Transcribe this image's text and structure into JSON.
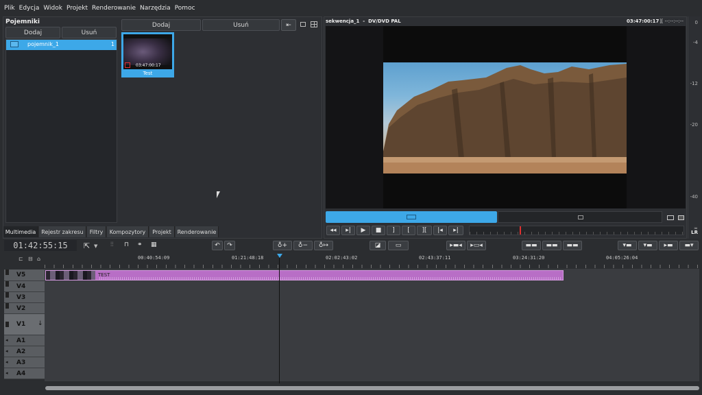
{
  "menu": [
    "Plik",
    "Edycja",
    "Widok",
    "Projekt",
    "Renderowanie",
    "Narzędzia",
    "Pomoc"
  ],
  "bins": {
    "title": "Pojemniki",
    "add_label": "Dodaj",
    "remove_label": "Usuń",
    "items": [
      {
        "name": "pojemnik_1",
        "count": "1"
      }
    ]
  },
  "media": {
    "add_label": "Dodaj",
    "remove_label": "Usuń",
    "clip": {
      "duration": "03:47:00:17",
      "name": "Test"
    }
  },
  "tabs": [
    "Multimedia",
    "Rejestr zakresu",
    "Filtry",
    "Kompozytory",
    "Projekt",
    "Renderowanie"
  ],
  "viewer": {
    "title": "sekwencja_1  -  DV/DVD PAL",
    "timecode": "03:47:00:17",
    "inout": "][ --:--:--:--"
  },
  "vu": {
    "scale": [
      "0",
      "-4",
      "-12",
      "-20",
      "-40",
      "∞"
    ],
    "channels": "LR"
  },
  "timeline": {
    "timecode": "01:42:55:15",
    "ruler": [
      "00:40:54:09",
      "01:21:48:18",
      "02:02:43:02",
      "02:43:37:11",
      "03:24:31:20",
      "04:05:26:04"
    ],
    "clip_label": "TEST",
    "tracks": [
      "V5",
      "V4",
      "V3",
      "V2",
      "V1",
      "A1",
      "A2",
      "A3",
      "A4"
    ]
  },
  "colors": {
    "accent": "#3da8e8",
    "clip": "#b86ec6",
    "bg": "#2b2d30"
  }
}
